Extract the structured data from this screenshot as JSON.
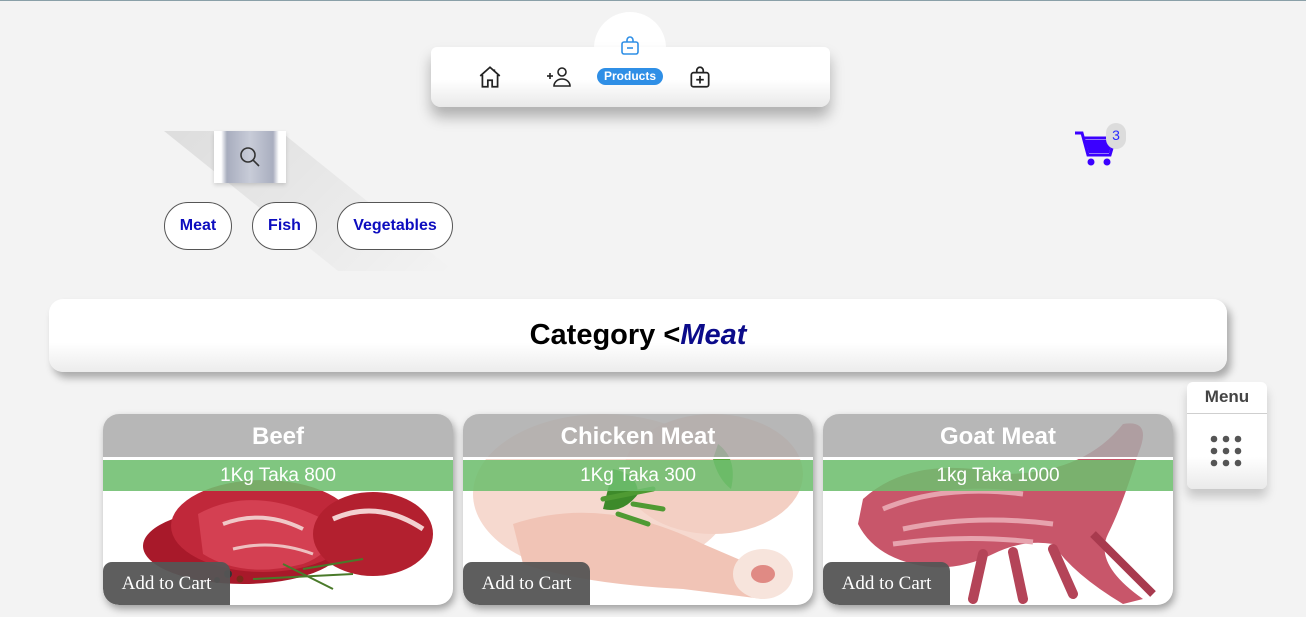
{
  "nav": {
    "items": [
      {
        "name": "home",
        "icon": "home-icon"
      },
      {
        "name": "add-user",
        "icon": "add-user-icon"
      },
      {
        "name": "products",
        "icon": "shopping-bag-icon",
        "label": "Products",
        "active": true
      },
      {
        "name": "add-product",
        "icon": "add-bag-icon"
      }
    ],
    "accent_color": "#2f8fe6"
  },
  "search": {
    "icon": "search-icon"
  },
  "filters": [
    "Meat",
    "Fish",
    "Vegetables"
  ],
  "cart": {
    "icon": "cart-icon",
    "count": "3",
    "color": "#3b00ff"
  },
  "category": {
    "prefix": "Category <",
    "value": "Meat"
  },
  "products": [
    {
      "name": "Beef",
      "price": "1Kg Taka 800",
      "button": "Add to Cart"
    },
    {
      "name": "Chicken Meat",
      "price": "1Kg Taka 300",
      "button": "Add to Cart"
    },
    {
      "name": "Goat Meat",
      "price": "1kg Taka 1000",
      "button": "Add to Cart"
    }
  ],
  "menu": {
    "label": "Menu",
    "icon": "grid-dots-icon"
  }
}
